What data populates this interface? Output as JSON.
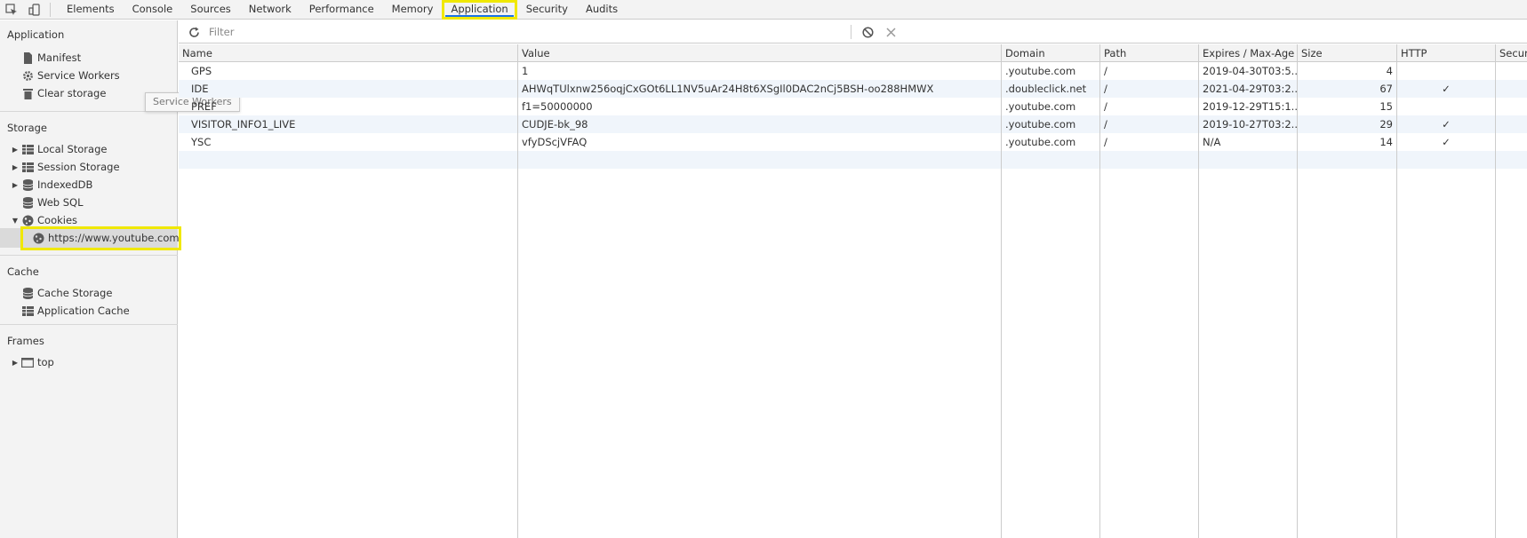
{
  "toolbar": {
    "tabs": [
      "Elements",
      "Console",
      "Sources",
      "Network",
      "Performance",
      "Memory",
      "Application",
      "Security",
      "Audits"
    ],
    "selected_tab": "Application",
    "inspect_icon": "inspect-element-icon",
    "device_icon": "device-toolbar-icon"
  },
  "sidebar": {
    "application": {
      "title": "Application",
      "items": [
        "Manifest",
        "Service Workers",
        "Clear storage"
      ]
    },
    "storage": {
      "title": "Storage",
      "items": [
        "Local Storage",
        "Session Storage",
        "IndexedDB",
        "Web SQL",
        "Cookies"
      ],
      "cookie_site": "https://www.youtube.com"
    },
    "cache": {
      "title": "Cache",
      "items": [
        "Cache Storage",
        "Application Cache"
      ]
    },
    "frames": {
      "title": "Frames",
      "items": [
        "top"
      ]
    },
    "tooltip": "Service Workers"
  },
  "filter": {
    "placeholder": "Filter"
  },
  "table": {
    "columns": [
      "Name",
      "Value",
      "Domain",
      "Path",
      "Expires / Max-Age",
      "Size",
      "HTTP",
      "Secure"
    ],
    "rows": [
      {
        "name": "GPS",
        "value": "1",
        "domain": ".youtube.com",
        "path": "/",
        "expires": "2019-04-30T03:5...",
        "size": "4",
        "http": ""
      },
      {
        "name": "IDE",
        "value": "AHWqTUlxnw256oqjCxGOt6LL1NV5uAr24H8t6XSgIl0DAC2nCj5BSH-oo288HMWX",
        "domain": ".doubleclick.net",
        "path": "/",
        "expires": "2021-04-29T03:2...",
        "size": "67",
        "http": "✓"
      },
      {
        "name": "PREF",
        "value": "f1=50000000",
        "domain": ".youtube.com",
        "path": "/",
        "expires": "2019-12-29T15:1...",
        "size": "15",
        "http": ""
      },
      {
        "name": "VISITOR_INFO1_LIVE",
        "value": "CUDJE-bk_98",
        "domain": ".youtube.com",
        "path": "/",
        "expires": "2019-10-27T03:2...",
        "size": "29",
        "http": "✓"
      },
      {
        "name": "YSC",
        "value": "vfyDScjVFAQ",
        "domain": ".youtube.com",
        "path": "/",
        "expires": "N/A",
        "size": "14",
        "http": "✓"
      }
    ]
  },
  "colors": {
    "highlight": "#f0e800",
    "panel_bg": "#f3f3f3",
    "alt_row": "#f0f5fb"
  }
}
